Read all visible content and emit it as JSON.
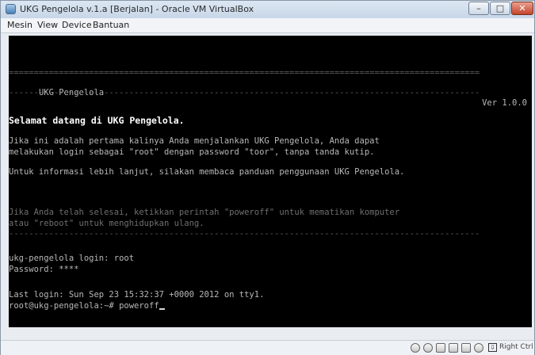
{
  "window": {
    "title": "UKG Pengelola v.1.a [Berjalan] - Oracle VM VirtualBox"
  },
  "menu": [
    "Mesin",
    "View",
    "Device",
    "Bantuan"
  ],
  "console": {
    "header_left": "UKG Pengelola",
    "header_right": "Ver 1.0.0",
    "welcome": "Selamat datang di UKG Pengelola.",
    "para1_line1": "Jika ini adalah pertama kalinya Anda menjalankan UKG Pengelola, Anda dapat",
    "para1_line2": "melakukan login sebagai \"root\" dengan password \"toor\", tanpa tanda kutip.",
    "para2": "Untuk informasi lebih lanjut, silakan membaca panduan penggunaan UKG Pengelola.",
    "para3_line1": "Jika Anda telah selesai, ketikkan perintah \"poweroff\" untuk mematikan komputer",
    "para3_line2": "atau \"reboot\" untuk menghidupkan ulang.",
    "login_line": "ukg-pengelola login: root",
    "password_line": "Password: ****",
    "last_login": "Last login: Sun Sep 23 15:32:37 +0000 2012 on tty1.",
    "prompt": "root@ukg-pengelola:~# poweroff"
  },
  "statusbar": {
    "host_key": "Right Ctrl"
  }
}
